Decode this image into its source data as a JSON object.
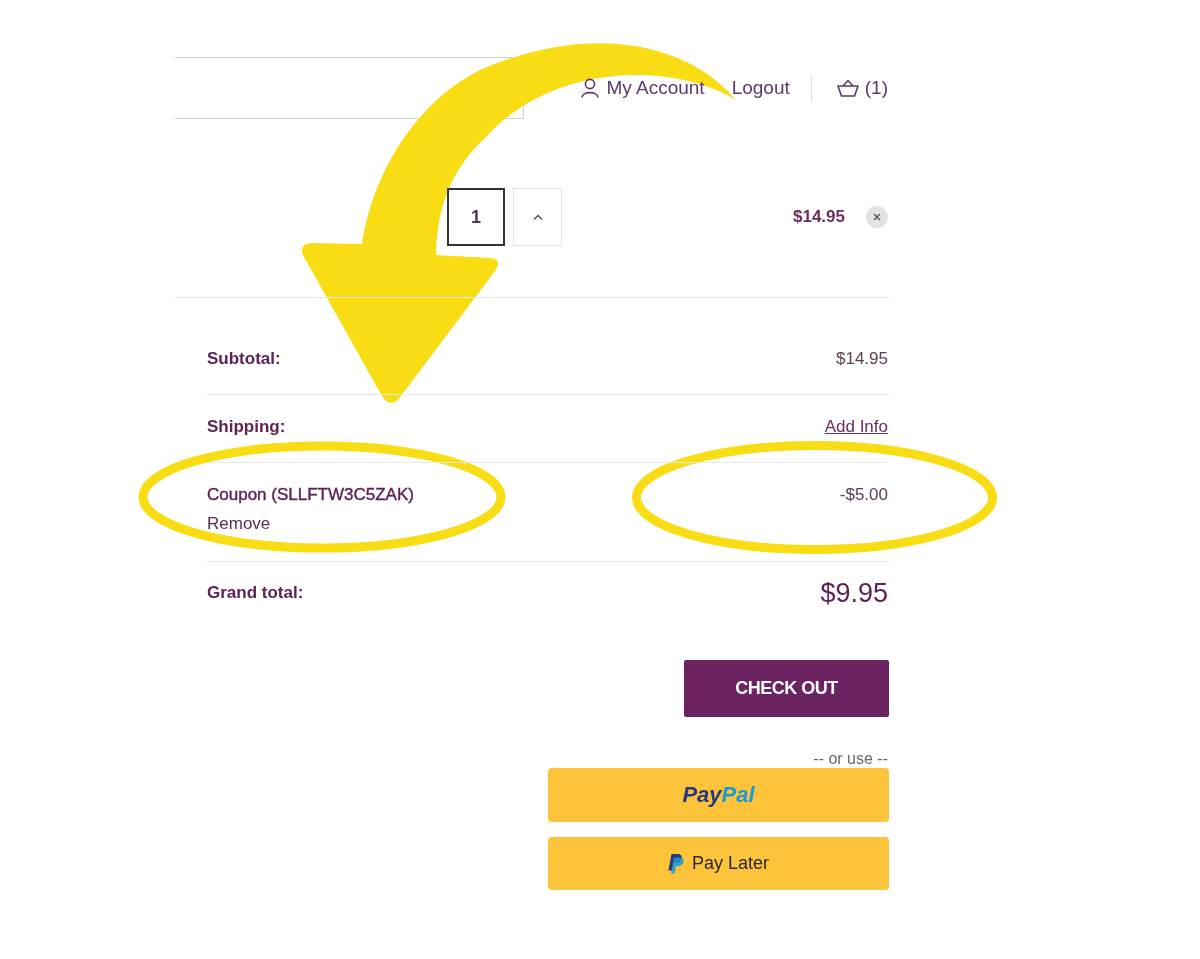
{
  "header": {
    "account_link": "My Account",
    "logout_link": "Logout",
    "cart_count": "(1)"
  },
  "cart_item": {
    "quantity": "1",
    "price": "$14.95"
  },
  "summary": [
    {
      "kind": "amount",
      "label": "Subtotal:",
      "value": "$14.95"
    },
    {
      "kind": "link",
      "label": "Shipping:",
      "value": "Add Info"
    },
    {
      "kind": "coupon",
      "label": "Coupon (SLLFTW3C5ZAK)",
      "action": "Remove",
      "value": "-$5.00"
    },
    {
      "kind": "total",
      "label": "Grand total:",
      "value": "$9.95"
    }
  ],
  "checkout": {
    "button": "CHECK OUT",
    "separator": "-- or use --",
    "wallets": [
      {
        "kind": "paypal",
        "label_parts": [
          "Pay",
          "Pal"
        ]
      },
      {
        "kind": "pay_later",
        "label": "Pay Later"
      }
    ]
  }
}
